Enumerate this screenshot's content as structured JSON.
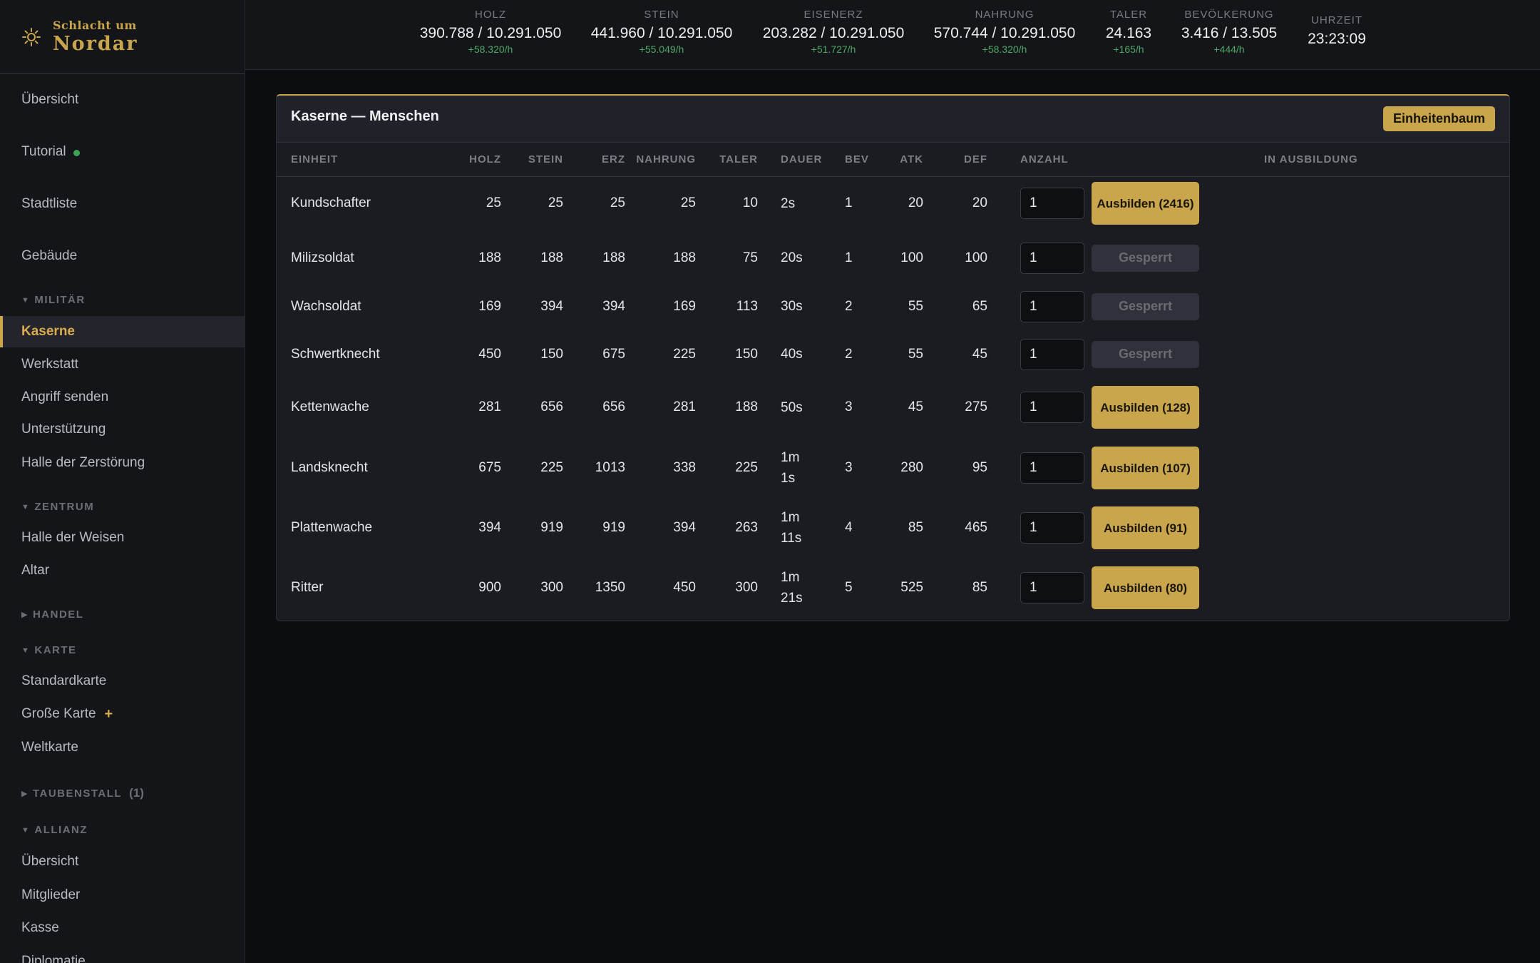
{
  "brand": {
    "subtitle": "Schlacht um",
    "title": "Nordar",
    "icon": "sun-icon"
  },
  "sidebar": {
    "items_top": [
      {
        "label": "Übersicht"
      },
      {
        "label": "Tutorial",
        "status": "green-dot"
      },
      {
        "label": "Stadtliste"
      },
      {
        "label": "Gebäude"
      }
    ],
    "militaer": {
      "label": "Militär",
      "items": [
        {
          "label": "Kaserne",
          "active": true
        },
        {
          "label": "Werkstatt"
        },
        {
          "label": "Angriff senden"
        },
        {
          "label": "Unterstützung"
        },
        {
          "label": "Halle der Zerstörung"
        }
      ]
    },
    "zentrum": {
      "label": "Zentrum",
      "items": [
        {
          "label": "Halle der Weisen"
        },
        {
          "label": "Altar"
        }
      ]
    },
    "handel": {
      "label": "Handel"
    },
    "karte": {
      "label": "Karte",
      "items": [
        {
          "label": "Standardkarte"
        },
        {
          "label": "Große Karte",
          "suffix": "+"
        },
        {
          "label": "Weltkarte"
        }
      ]
    },
    "taubenstall": {
      "label": "Taubenstall",
      "count": "(1)"
    },
    "allianz": {
      "label": "Allianz",
      "items": [
        {
          "label": "Übersicht"
        },
        {
          "label": "Mitglieder"
        },
        {
          "label": "Kasse"
        },
        {
          "label": "Diplomatie"
        }
      ]
    }
  },
  "resources": [
    {
      "label": "Holz",
      "value": "390.788 / 10.291.050",
      "rate": "+58.320/h"
    },
    {
      "label": "Stein",
      "value": "441.960 / 10.291.050",
      "rate": "+55.049/h"
    },
    {
      "label": "Eisenerz",
      "value": "203.282 / 10.291.050",
      "rate": "+51.727/h"
    },
    {
      "label": "Nahrung",
      "value": "570.744 / 10.291.050",
      "rate": "+58.320/h"
    },
    {
      "label": "Taler",
      "value": "24.163",
      "rate": "+165/h"
    },
    {
      "label": "Bevölkerung",
      "value": "3.416 / 13.505",
      "rate": "+444/h"
    },
    {
      "label": "Uhrzeit",
      "value": "23:23:09"
    }
  ],
  "panel": {
    "title": "Kaserne — Menschen",
    "tree_button": "Einheitenbaum",
    "columns": {
      "unit": "Einheit",
      "holz": "Holz",
      "stein": "Stein",
      "erz": "Erz",
      "nahrung": "Nahrung",
      "taler": "Taler",
      "dauer": "Dauer",
      "bev": "Bev",
      "atk": "Atk",
      "def": "Def",
      "anzahl": "Anzahl",
      "training": "In Ausbildung"
    },
    "units": [
      {
        "name": "Kundschafter",
        "holz": "25",
        "stein": "25",
        "erz": "25",
        "nahrung": "25",
        "taler": "10",
        "dauer": "2s",
        "bev": "1",
        "atk": "20",
        "def": "20",
        "qty": "1",
        "action": "Ausbilden (2416)",
        "locked": false
      },
      {
        "name": "Milizsoldat",
        "holz": "188",
        "stein": "188",
        "erz": "188",
        "nahrung": "188",
        "taler": "75",
        "dauer": "20s",
        "bev": "1",
        "atk": "100",
        "def": "100",
        "qty": "1",
        "action": "Gesperrt",
        "locked": true
      },
      {
        "name": "Wachsoldat",
        "holz": "169",
        "stein": "394",
        "erz": "394",
        "nahrung": "169",
        "taler": "113",
        "dauer": "30s",
        "bev": "2",
        "atk": "55",
        "def": "65",
        "qty": "1",
        "action": "Gesperrt",
        "locked": true
      },
      {
        "name": "Schwertknecht",
        "holz": "450",
        "stein": "150",
        "erz": "675",
        "nahrung": "225",
        "taler": "150",
        "dauer": "40s",
        "bev": "2",
        "atk": "55",
        "def": "45",
        "qty": "1",
        "action": "Gesperrt",
        "locked": true
      },
      {
        "name": "Kettenwache",
        "holz": "281",
        "stein": "656",
        "erz": "656",
        "nahrung": "281",
        "taler": "188",
        "dauer": "50s",
        "bev": "3",
        "atk": "45",
        "def": "275",
        "qty": "1",
        "action": "Ausbilden (128)",
        "locked": false
      },
      {
        "name": "Landsknecht",
        "holz": "675",
        "stein": "225",
        "erz": "1013",
        "nahrung": "338",
        "taler": "225",
        "dauer": "1m 1s",
        "bev": "3",
        "atk": "280",
        "def": "95",
        "qty": "1",
        "action": "Ausbilden (107)",
        "locked": false
      },
      {
        "name": "Plattenwache",
        "holz": "394",
        "stein": "919",
        "erz": "919",
        "nahrung": "394",
        "taler": "263",
        "dauer": "1m 11s",
        "bev": "4",
        "atk": "85",
        "def": "465",
        "qty": "1",
        "action": "Ausbilden (91)",
        "locked": false
      },
      {
        "name": "Ritter",
        "holz": "900",
        "stein": "300",
        "erz": "1350",
        "nahrung": "450",
        "taler": "300",
        "dauer": "1m 21s",
        "bev": "5",
        "atk": "525",
        "def": "85",
        "qty": "1",
        "action": "Ausbilden (80)",
        "locked": false
      }
    ]
  }
}
